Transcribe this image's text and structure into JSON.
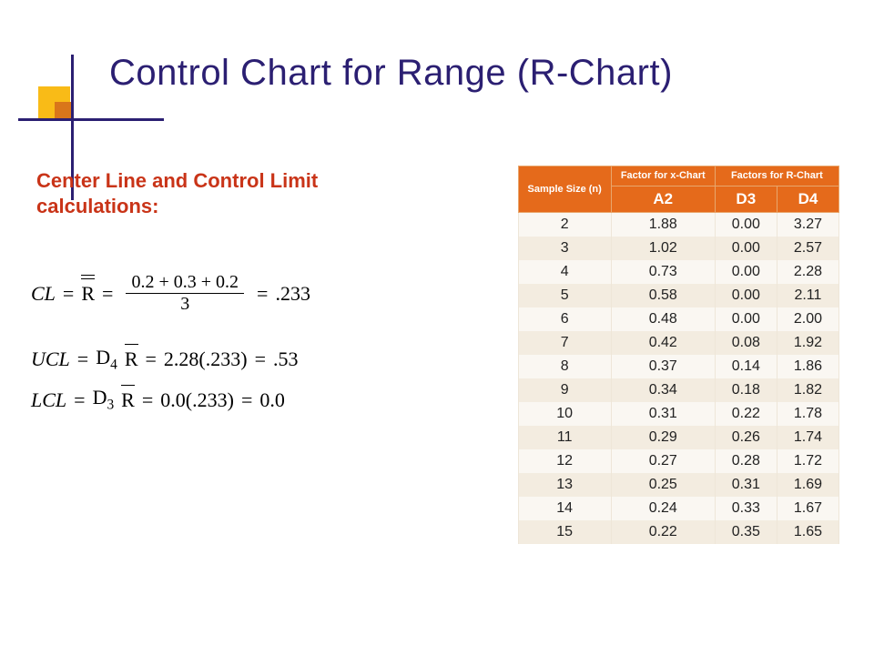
{
  "title": "Control Chart for Range (R-Chart)",
  "subtitle": "Center Line and Control Limit calculations:",
  "formulas": {
    "cl_label": "CL",
    "eq_sign": "=",
    "rbar_sym": "R",
    "cl_numerator": "0.2 + 0.3 + 0.2",
    "cl_denominator": "3",
    "cl_result": ".233",
    "ucl_label": "UCL",
    "ucl_factor": "D",
    "ucl_sub": "4",
    "ucl_expr": "2.28(.233)",
    "ucl_result": ".53",
    "lcl_label": "LCL",
    "lcl_factor": "D",
    "lcl_sub": "3",
    "lcl_expr": "0.0(.233)",
    "lcl_result": "0.0"
  },
  "table": {
    "head_sample": "Sample Size\n(n)",
    "head_x": "Factor for x-Chart",
    "head_r": "Factors for R-Chart",
    "col_a2": "A2",
    "col_d3": "D3",
    "col_d4": "D4",
    "rows": [
      {
        "n": "2",
        "a2": "1.88",
        "d3": "0.00",
        "d4": "3.27"
      },
      {
        "n": "3",
        "a2": "1.02",
        "d3": "0.00",
        "d4": "2.57"
      },
      {
        "n": "4",
        "a2": "0.73",
        "d3": "0.00",
        "d4": "2.28"
      },
      {
        "n": "5",
        "a2": "0.58",
        "d3": "0.00",
        "d4": "2.11"
      },
      {
        "n": "6",
        "a2": "0.48",
        "d3": "0.00",
        "d4": "2.00"
      },
      {
        "n": "7",
        "a2": "0.42",
        "d3": "0.08",
        "d4": "1.92"
      },
      {
        "n": "8",
        "a2": "0.37",
        "d3": "0.14",
        "d4": "1.86"
      },
      {
        "n": "9",
        "a2": "0.34",
        "d3": "0.18",
        "d4": "1.82"
      },
      {
        "n": "10",
        "a2": "0.31",
        "d3": "0.22",
        "d4": "1.78"
      },
      {
        "n": "11",
        "a2": "0.29",
        "d3": "0.26",
        "d4": "1.74"
      },
      {
        "n": "12",
        "a2": "0.27",
        "d3": "0.28",
        "d4": "1.72"
      },
      {
        "n": "13",
        "a2": "0.25",
        "d3": "0.31",
        "d4": "1.69"
      },
      {
        "n": "14",
        "a2": "0.24",
        "d3": "0.33",
        "d4": "1.67"
      },
      {
        "n": "15",
        "a2": "0.22",
        "d3": "0.35",
        "d4": "1.65"
      }
    ]
  }
}
